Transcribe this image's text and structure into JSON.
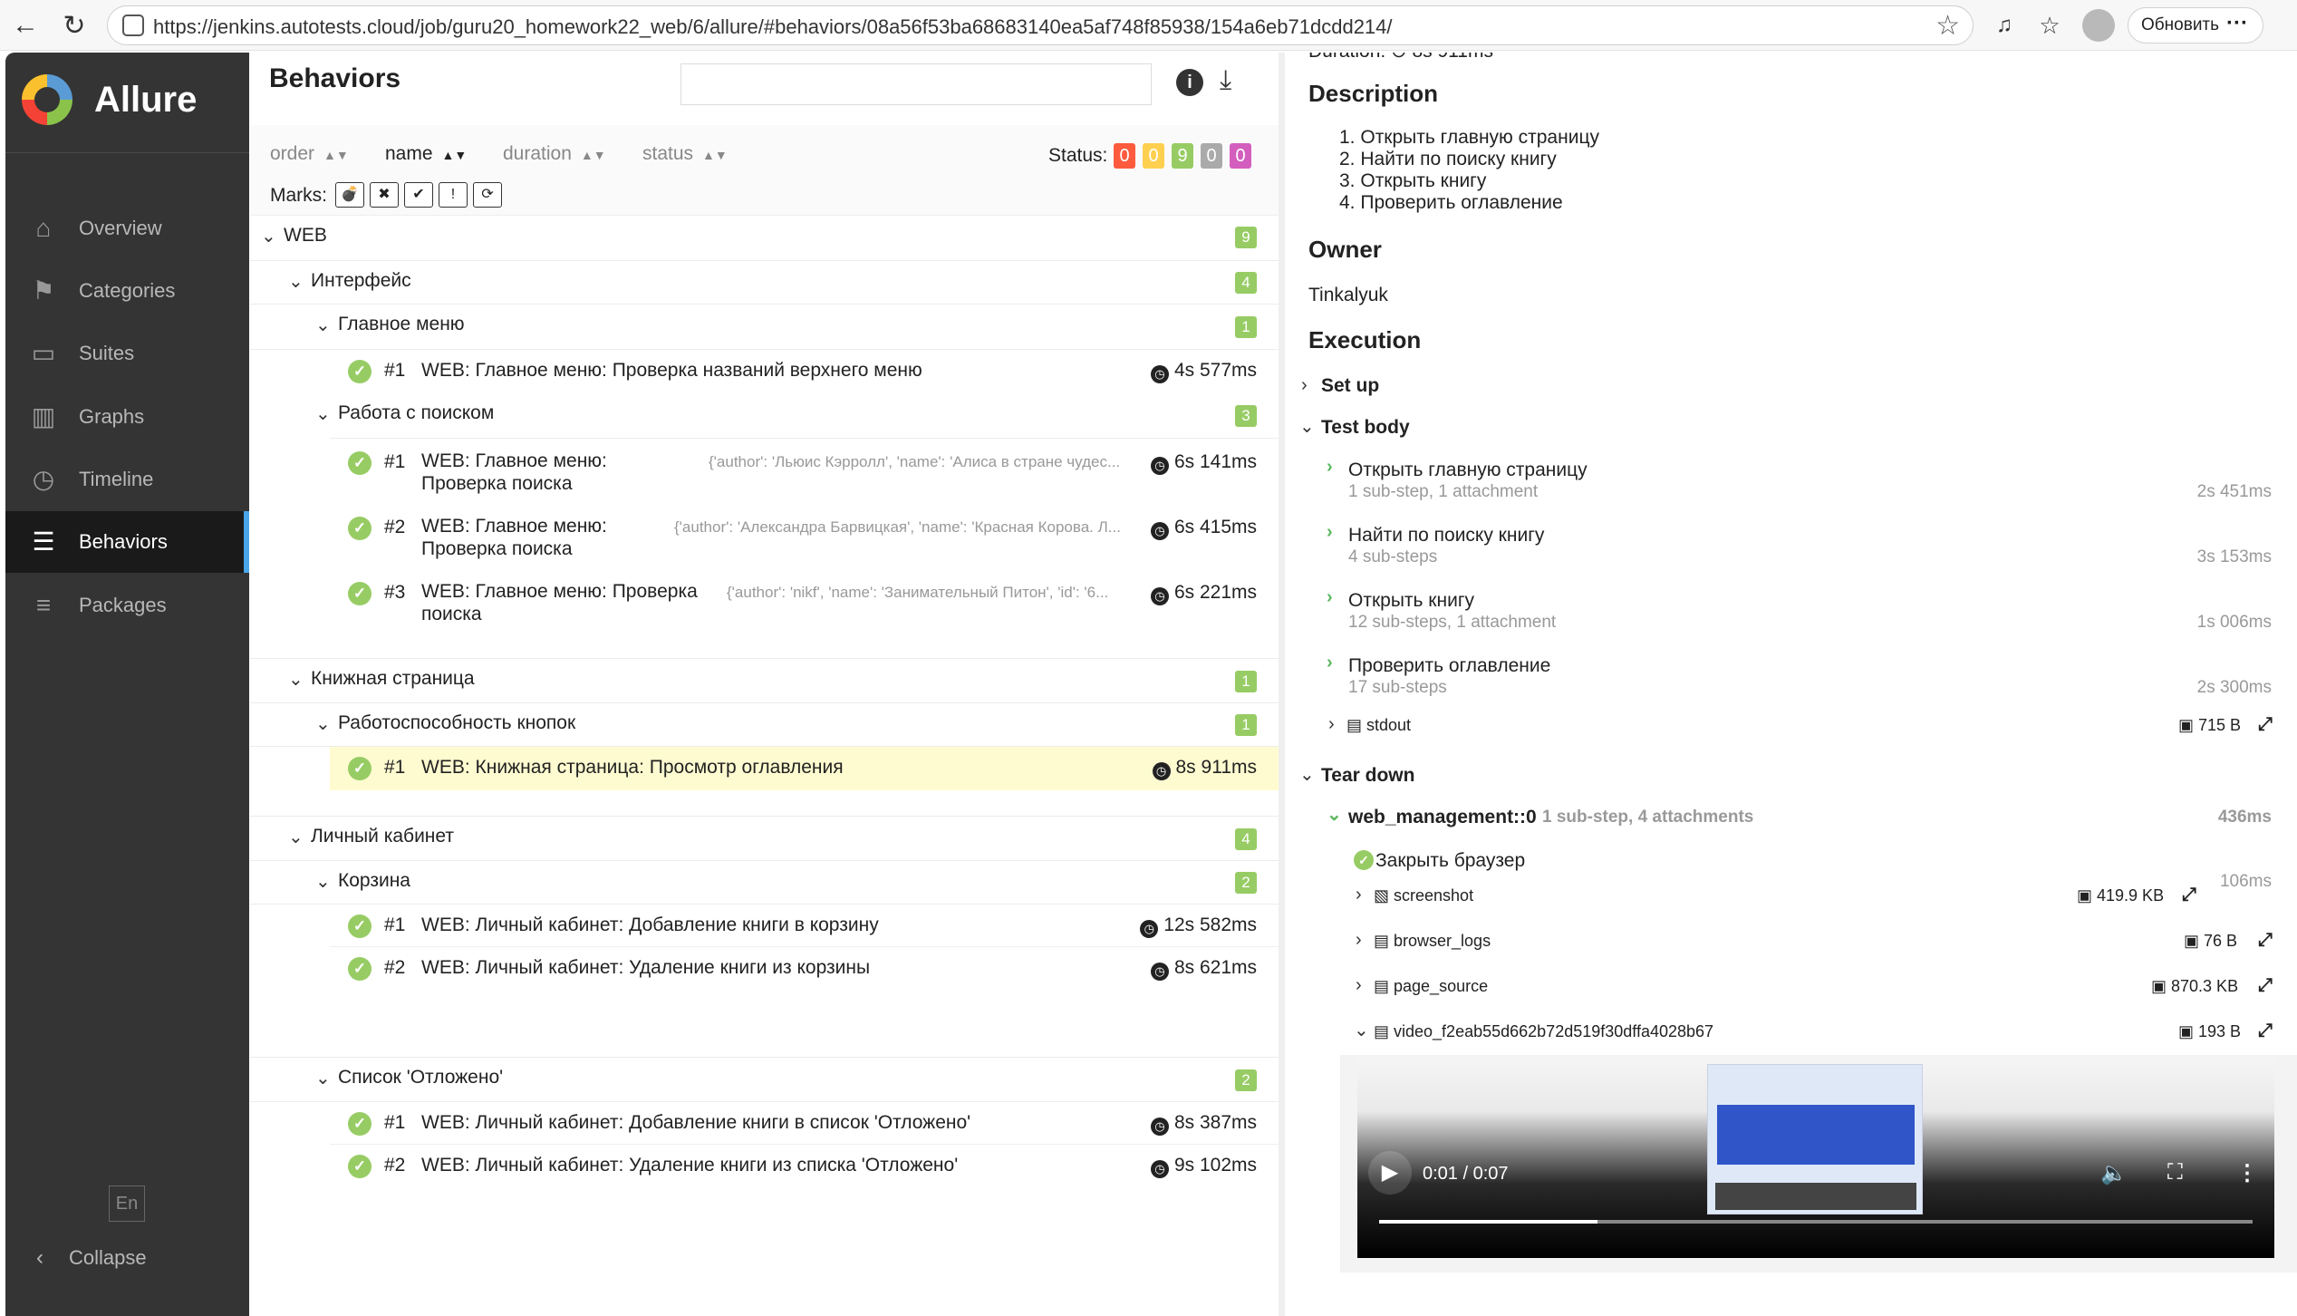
{
  "browser": {
    "url": "https://jenkins.autotests.cloud/job/guru20_homework22_web/6/allure/#behaviors/08a56f53ba68683140ea5af748f85938/154a6eb71dcdd214/",
    "update_label": "Обновить"
  },
  "sidebar": {
    "brand": "Allure",
    "items": [
      {
        "label": "Overview",
        "icon": "home-icon"
      },
      {
        "label": "Categories",
        "icon": "flag-icon"
      },
      {
        "label": "Suites",
        "icon": "briefcase-icon"
      },
      {
        "label": "Graphs",
        "icon": "bar-chart-icon"
      },
      {
        "label": "Timeline",
        "icon": "clock-icon"
      },
      {
        "label": "Behaviors",
        "icon": "list-icon",
        "active": true
      },
      {
        "label": "Packages",
        "icon": "packages-icon"
      }
    ],
    "lang": "En",
    "collapse": "Collapse"
  },
  "behaviors": {
    "title": "Behaviors",
    "sort": {
      "order": "order",
      "name": "name",
      "duration": "duration",
      "status": "status"
    },
    "status_label": "Status:",
    "status_counts": [
      {
        "value": "0",
        "color": "#fd5a3e"
      },
      {
        "value": "0",
        "color": "#ffd050"
      },
      {
        "value": "9",
        "color": "#97cc64"
      },
      {
        "value": "0",
        "color": "#aaaaaa"
      },
      {
        "value": "0",
        "color": "#d35ebe"
      }
    ],
    "marks_label": "Marks:",
    "groups": {
      "web": {
        "label": "WEB",
        "count": "9"
      },
      "interface": {
        "label": "Интерфейс",
        "count": "4"
      },
      "main_menu": {
        "label": "Главное меню",
        "count": "1"
      },
      "search_work": {
        "label": "Работа с поиском",
        "count": "3"
      },
      "book_page": {
        "label": "Книжная страница",
        "count": "1"
      },
      "buttons": {
        "label": "Работоспособность кнопок",
        "count": "1"
      },
      "cabinet": {
        "label": "Личный кабинет",
        "count": "4"
      },
      "cart": {
        "label": "Корзина",
        "count": "2"
      },
      "deferred": {
        "label": "Список 'Отложено'",
        "count": "2"
      }
    },
    "tests": [
      {
        "num": "#1",
        "name": "WEB: Главное меню: Проверка названий верхнего меню",
        "params": "",
        "duration": "4s 577ms"
      },
      {
        "num": "#1",
        "name": "WEB: Главное меню: Проверка поиска",
        "params": "{'author': 'Льюис Кэрролл', 'name': 'Алиса в стране чудес...",
        "duration": "6s 141ms"
      },
      {
        "num": "#2",
        "name": "WEB: Главное меню: Проверка поиска",
        "params": "{'author': 'Александра Барвицкая', 'name': 'Красная Корова. Л...",
        "duration": "6s 415ms"
      },
      {
        "num": "#3",
        "name": "WEB: Главное меню: Проверка поиска",
        "params": "{'author': 'nikf', 'name': 'Занимательный Питон', 'id': '6...",
        "duration": "6s 221ms"
      },
      {
        "num": "#1",
        "name": "WEB: Книжная страница: Просмотр оглавления",
        "params": "",
        "duration": "8s 911ms"
      },
      {
        "num": "#1",
        "name": "WEB: Личный кабинет: Добавление книги в корзину",
        "params": "",
        "duration": "12s 582ms"
      },
      {
        "num": "#2",
        "name": "WEB: Личный кабинет: Удаление книги из корзины",
        "params": "",
        "duration": "8s 621ms"
      },
      {
        "num": "#1",
        "name": "WEB: Личный кабинет: Добавление книги в список 'Отложено'",
        "params": "",
        "duration": "8s 387ms"
      },
      {
        "num": "#2",
        "name": "WEB: Личный кабинет: Удаление книги из списка 'Отложено'",
        "params": "",
        "duration": "9s 102ms"
      }
    ]
  },
  "details": {
    "duration_partial": "Duration: ⊙ 8s 911ms",
    "description_title": "Description",
    "description_items": [
      "Открыть главную страницу",
      "Найти по поиску книгу",
      "Открыть книгу",
      "Проверить оглавление"
    ],
    "owner_title": "Owner",
    "owner": "Tinkalyuk",
    "execution_title": "Execution",
    "setup": "Set up",
    "test_body": "Test body",
    "steps": [
      {
        "name": "Открыть главную страницу",
        "sub": "1 sub-step, 1 attachment",
        "duration": "2s 451ms"
      },
      {
        "name": "Найти по поиску книгу",
        "sub": "4 sub-steps",
        "duration": "3s 153ms"
      },
      {
        "name": "Открыть книгу",
        "sub": "12 sub-steps, 1 attachment",
        "duration": "1s 006ms"
      },
      {
        "name": "Проверить оглавление",
        "sub": "17 sub-steps",
        "duration": "2s 300ms"
      }
    ],
    "stdout": {
      "name": "stdout",
      "size": "715 B"
    },
    "tear_down": "Tear down",
    "fixture": {
      "name": "web_management::0",
      "sub": "1 sub-step, 4 attachments",
      "duration": "436ms"
    },
    "close_browser": {
      "name": "Закрыть браузер",
      "duration": "106ms"
    },
    "attachments": [
      {
        "name": "screenshot",
        "size": "419.9 KB"
      },
      {
        "name": "browser_logs",
        "size": "76 B"
      },
      {
        "name": "page_source",
        "size": "870.3 KB"
      },
      {
        "name": "video_f2eab55d662b72d519f30dffa4028b67",
        "size": "193 B"
      }
    ],
    "video_time": "0:01 / 0:07",
    "video_progress": 0.25
  }
}
